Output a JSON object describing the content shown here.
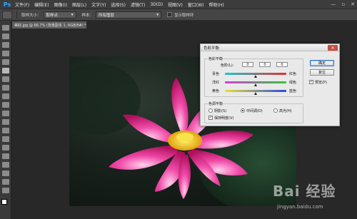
{
  "app": {
    "logo": "Ps"
  },
  "menu": [
    "文件(F)",
    "编辑(E)",
    "图像(I)",
    "图层(L)",
    "文字(Y)",
    "选择(S)",
    "滤镜(T)",
    "3D(D)",
    "视图(V)",
    "窗口(W)",
    "帮助(H)"
  ],
  "window_controls": {
    "minimize": "—",
    "maximize": "▫",
    "close": "✕"
  },
  "options": {
    "sample_size_label": "取样大小：",
    "sample_size_value": "取样点",
    "sample_label": "样本：",
    "sample_value": "所有图层",
    "show_ring_label": "显示取样环"
  },
  "document": {
    "tab_title": "美好.jpg @ 66.7% (背景副本 1, RGB/8#) *"
  },
  "dialog": {
    "title": "色彩平衡",
    "balance_group_label": "色彩平衡",
    "levels_label": "色阶(L):",
    "levels": [
      "0",
      "0",
      "0"
    ],
    "sliders": [
      {
        "left": "青色",
        "right": "红色",
        "position": 0.5
      },
      {
        "left": "洋红",
        "right": "绿色",
        "position": 0.5
      },
      {
        "left": "黄色",
        "right": "蓝色",
        "position": 0.5
      }
    ],
    "tone_group_label": "色调平衡",
    "tones": [
      "阴影(S)",
      "中间调(D)",
      "高光(H)"
    ],
    "selected_tone": "中间调(D)",
    "preserve_luminosity": "保持明度(V)",
    "ok_label": "确定",
    "reset_label": "复位",
    "preview_label": "预览(P)"
  },
  "watermark": {
    "logo": "Bai 经验",
    "url": "jingyan.baidu.com"
  },
  "colors": {
    "accent": "#2fa8ff",
    "close": "#c84d3c"
  }
}
